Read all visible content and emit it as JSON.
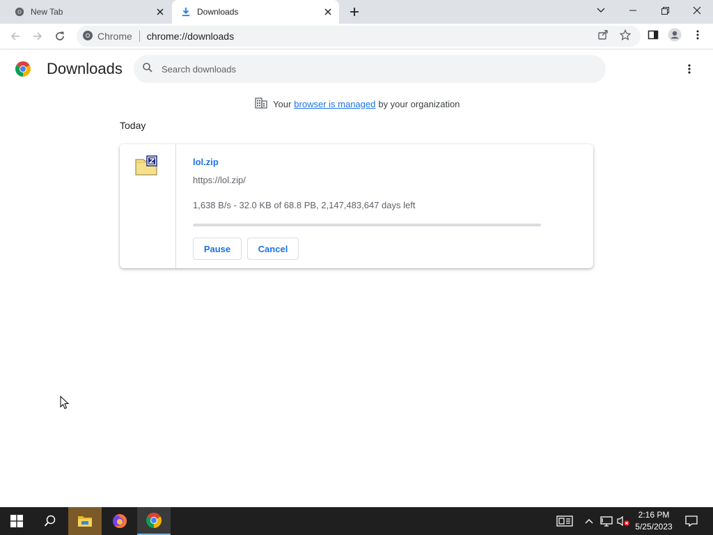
{
  "tabs": [
    {
      "title": "New Tab",
      "active": false
    },
    {
      "title": "Downloads",
      "active": true
    }
  ],
  "omnibox": {
    "site_label": "Chrome",
    "url": "chrome://downloads"
  },
  "downloads_page": {
    "title": "Downloads",
    "search_placeholder": "Search downloads",
    "managed_notice": {
      "prefix": "Your",
      "link": "browser is managed",
      "suffix": "by your organization"
    },
    "date_header": "Today",
    "items": [
      {
        "file_name": "lol.zip",
        "url": "https://lol.zip/",
        "status": "1,638 B/s - 32.0 KB of 68.8 PB, 2,147,483,647 days left",
        "progress_percent": 0,
        "pause_label": "Pause",
        "cancel_label": "Cancel"
      }
    ]
  },
  "taskbar": {
    "apps": [
      "start",
      "search",
      "file-explorer",
      "firefox",
      "chrome"
    ],
    "clock_time": "2:16 PM",
    "clock_date": "5/25/2023"
  },
  "colors": {
    "accent": "#1a73e8",
    "tabstrip_bg": "#dee1e6",
    "omnibox_bg": "#f1f3f4",
    "taskbar_bg": "#1f1f1f"
  }
}
